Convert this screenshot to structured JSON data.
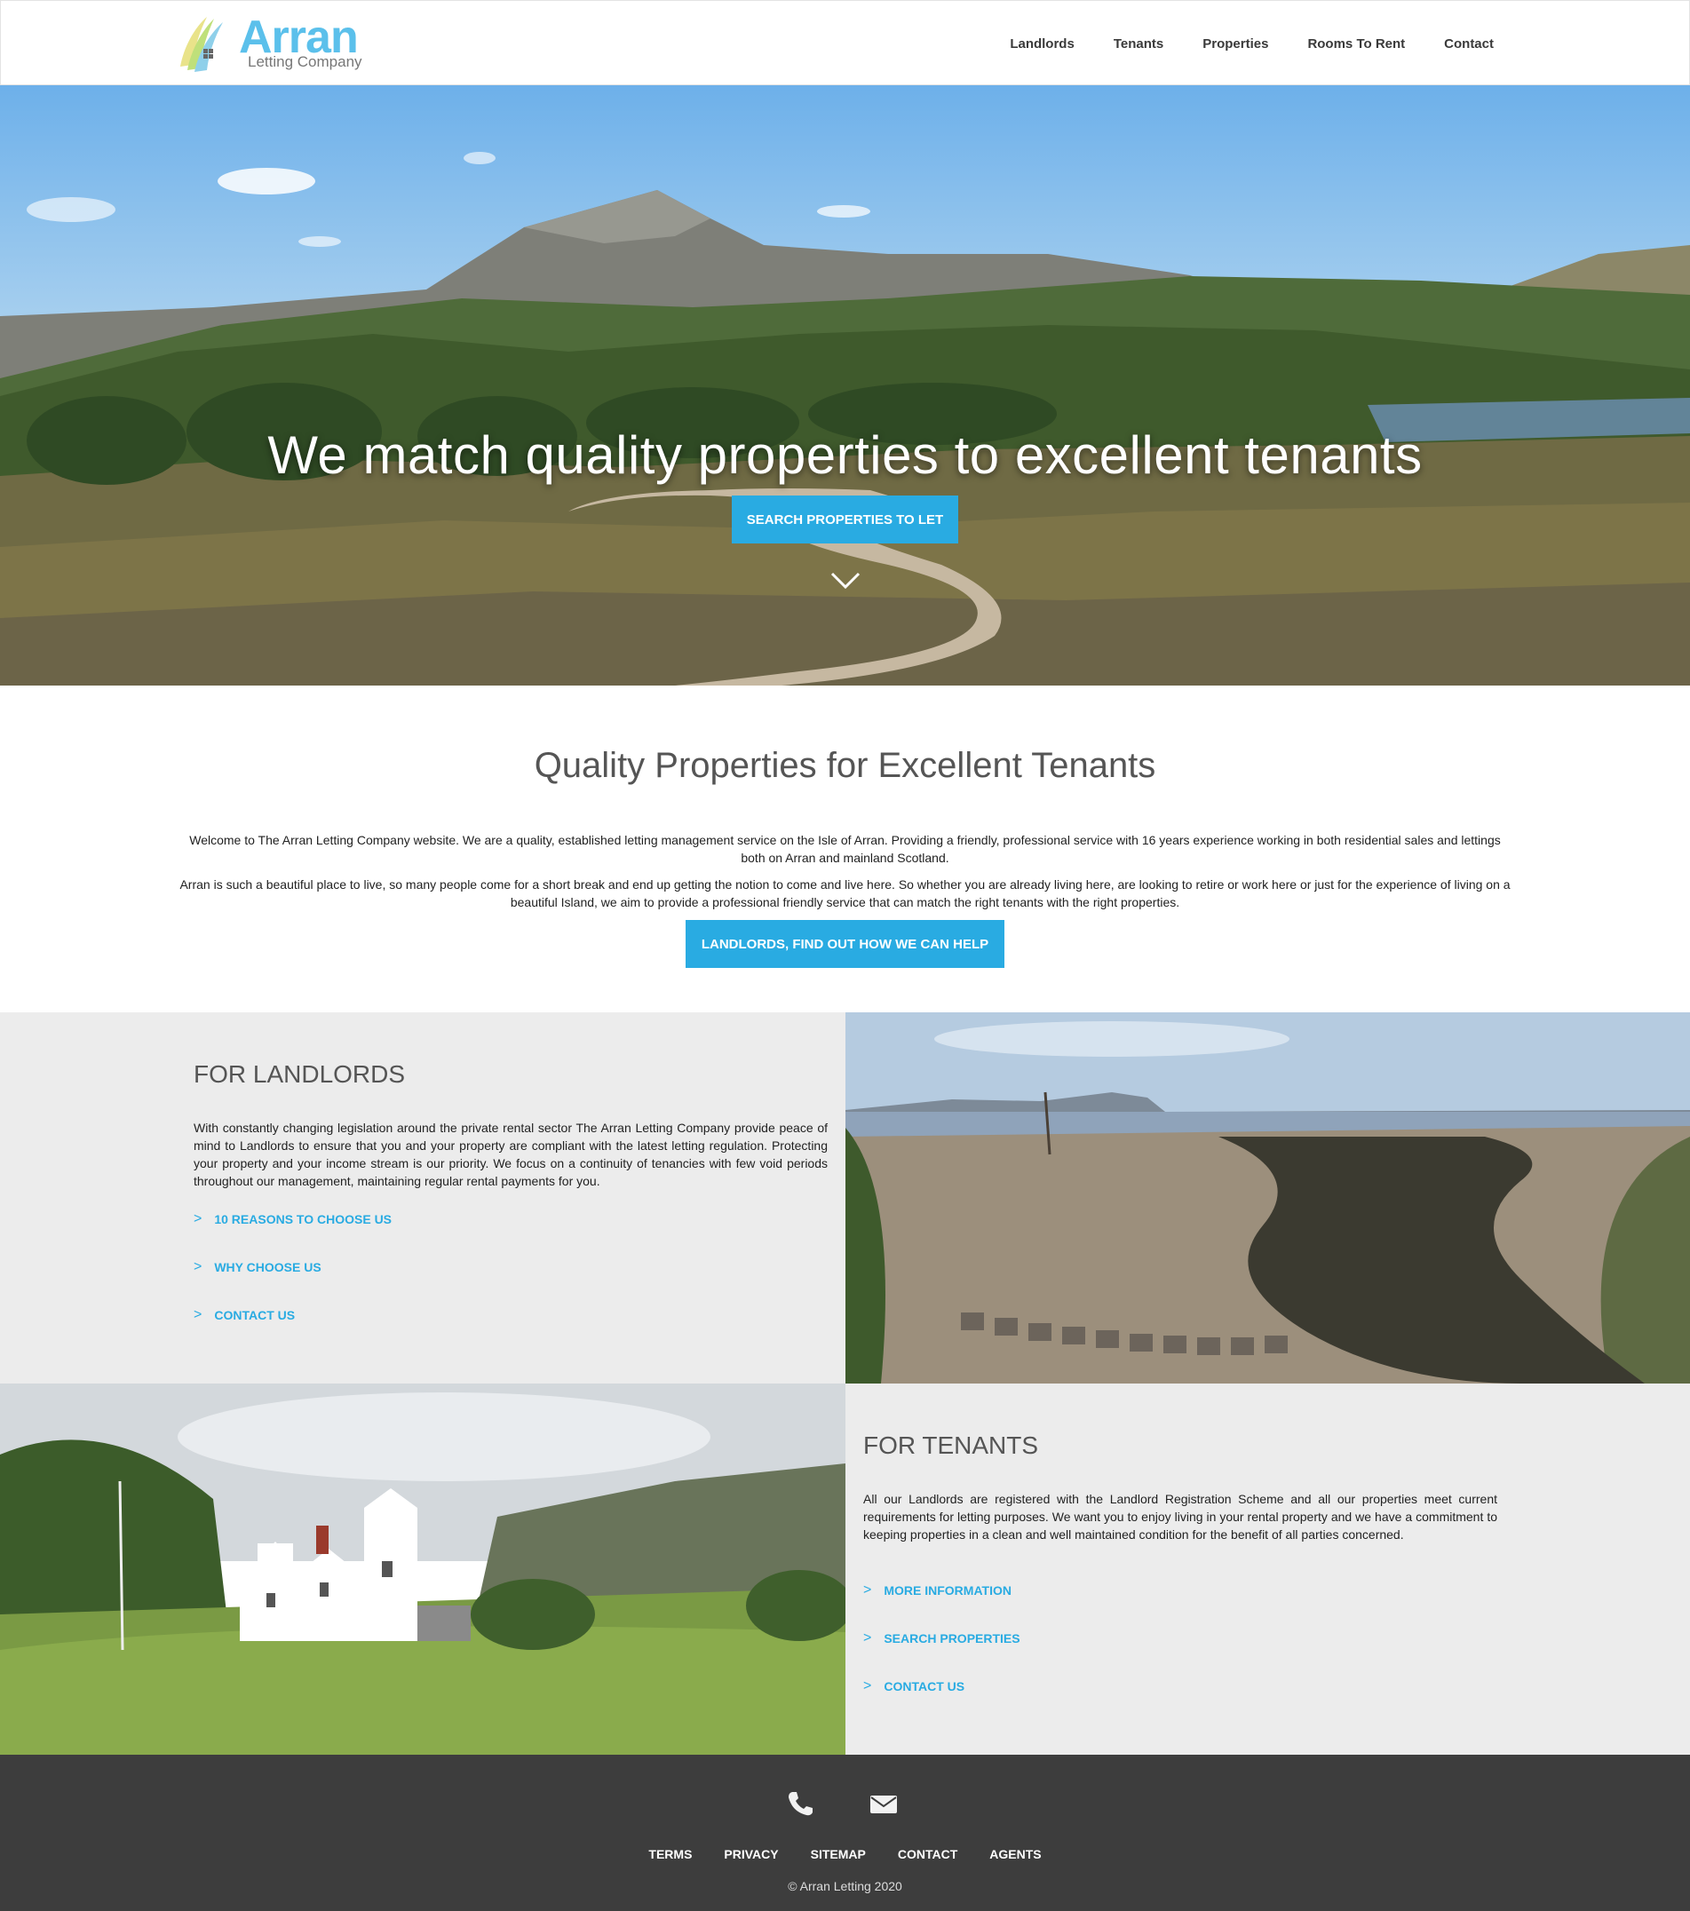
{
  "brand": {
    "name": "Arran",
    "subtitle": "Letting Company",
    "accent": "#29abe2",
    "logo_blue": "#5bc0eb"
  },
  "nav": {
    "items": [
      "Landlords",
      "Tenants",
      "Properties",
      "Rooms To Rent",
      "Contact"
    ]
  },
  "hero": {
    "title": "We match quality properties to excellent tenants",
    "button": "SEARCH PROPERTIES TO LET",
    "scroll_icon": "chevron-down-icon"
  },
  "intro": {
    "heading": "Quality Properties for Excellent Tenants",
    "p1": "Welcome to The Arran Letting Company website. We are a quality, established letting management service on the Isle of Arran. Providing a friendly, professional service with 16 years experience working in both residential sales and lettings both on Arran and mainland Scotland.",
    "p2": "Arran is such a beautiful place to live, so many people come for a short break and end up getting the notion to come and live here. So whether you are already living here, are looking to retire or work here or just for the experience of living on a beautiful Island, we aim to provide a professional friendly service that can match the right tenants with the right properties.",
    "button": "LANDLORDS, FIND OUT HOW WE CAN HELP"
  },
  "landlords": {
    "heading": "FOR LANDLORDS",
    "text": "With constantly changing legislation around the private rental sector The Arran Letting Company provide peace of mind to Landlords to ensure that you and your property are compliant with the latest letting regulation. Protecting your property and your income stream is our priority. We focus on a continuity of tenancies with few void periods throughout our management, maintaining regular rental payments for you.",
    "links": [
      "10 REASONS TO CHOOSE US",
      "WHY CHOOSE US",
      "CONTACT US"
    ]
  },
  "tenants": {
    "heading": "FOR TENANTS",
    "text": "All our Landlords are registered with the Landlord Registration Scheme and all our properties meet current requirements for letting purposes. We want you to enjoy living in your rental property and we have a commitment to keeping properties in a clean and well maintained condition for the benefit of all parties concerned.",
    "links": [
      "MORE INFORMATION",
      "SEARCH PROPERTIES",
      "CONTACT US"
    ]
  },
  "link_arrow": ">",
  "footer": {
    "icons": [
      "phone-icon",
      "envelope-icon"
    ],
    "links": [
      "TERMS",
      "PRIVACY",
      "SITEMAP",
      "CONTACT",
      "AGENTS"
    ],
    "copyright": "© Arran Letting 2020"
  }
}
